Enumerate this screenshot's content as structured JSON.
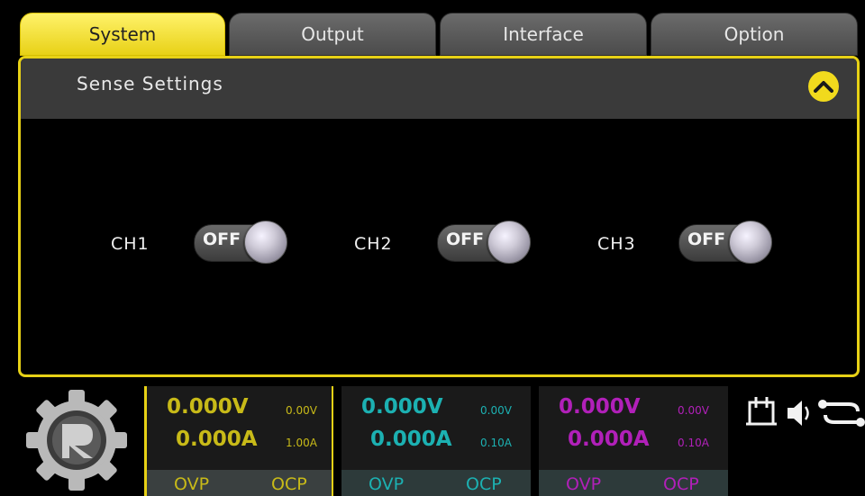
{
  "tabs": [
    {
      "label": "System",
      "active": true
    },
    {
      "label": "Output",
      "active": false
    },
    {
      "label": "Interface",
      "active": false
    },
    {
      "label": "Option",
      "active": false
    }
  ],
  "panel": {
    "title": "Sense Settings",
    "collapse_icon": "chevron-up-icon"
  },
  "sense": [
    {
      "channel": "CH1",
      "state": "OFF"
    },
    {
      "channel": "CH2",
      "state": "OFF"
    },
    {
      "channel": "CH3",
      "state": "OFF"
    }
  ],
  "outputs": [
    {
      "voltage": "0.000V",
      "current": "0.000A",
      "set_voltage": "0.00V",
      "set_current": "1.00A",
      "ovp": "OVP",
      "ocp": "OCP",
      "color": "#c8ba18"
    },
    {
      "voltage": "0.000V",
      "current": "0.000A",
      "set_voltage": "0.00V",
      "set_current": "0.10A",
      "ovp": "OVP",
      "ocp": "OCP",
      "color": "#1cb1b2"
    },
    {
      "voltage": "0.000V",
      "current": "0.000A",
      "set_voltage": "0.00V",
      "set_current": "0.10A",
      "ovp": "OVP",
      "ocp": "OCP",
      "color": "#b120b9"
    }
  ],
  "status_icons": [
    "screen-connect-icon",
    "speaker-icon",
    "usb-icon"
  ],
  "colors": {
    "accent": "#f1da1d",
    "ch1": "#c8ba18",
    "ch2": "#1cb1b2",
    "ch3": "#b120b9"
  }
}
